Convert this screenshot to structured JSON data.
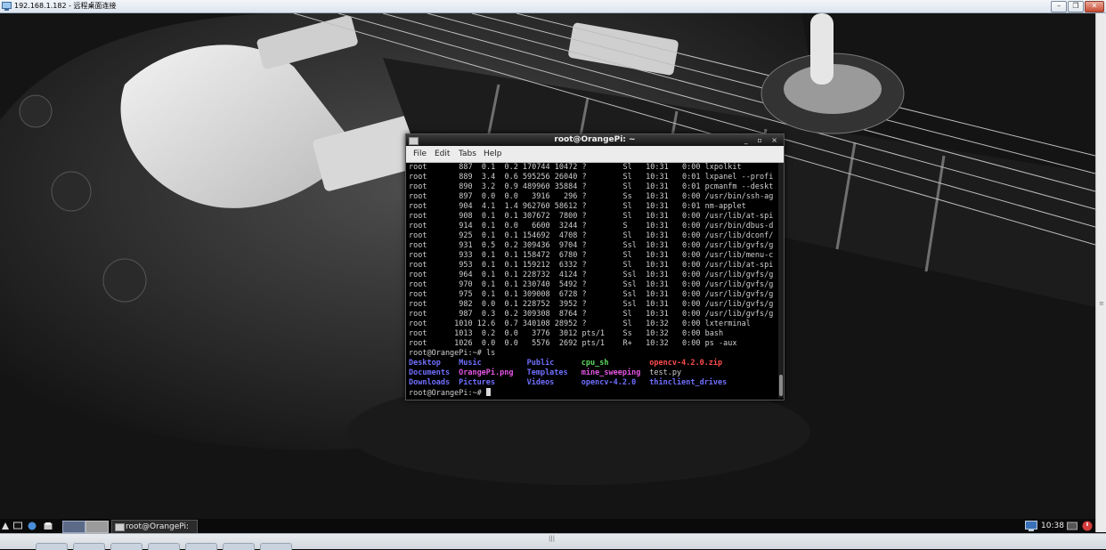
{
  "window": {
    "title": "192.168.1.182 - 远程桌面连接",
    "buttons": [
      "–",
      "❐",
      "✕"
    ]
  },
  "terminal": {
    "title": "root@OrangePi: ~",
    "title_buttons": "_ ▫ ×",
    "menu": [
      "File",
      "Edit",
      "Tabs",
      "Help"
    ],
    "ps_lines": [
      "root       887  0.1  0.2 170744 10472 ?        Sl   10:31   0:00 lxpolkit",
      "root       889  3.4  0.6 595256 26040 ?        Sl   10:31   0:01 lxpanel --profi",
      "root       890  3.2  0.9 489960 35884 ?        Sl   10:31   0:01 pcmanfm --deskt",
      "root       897  0.0  0.0   3916   296 ?        Ss   10:31   0:00 /usr/bin/ssh-ag",
      "root       904  4.1  1.4 962760 58612 ?        Sl   10:31   0:01 nm-applet",
      "root       908  0.1  0.1 307672  7800 ?        Sl   10:31   0:00 /usr/lib/at-spi",
      "root       914  0.1  0.0   6600  3244 ?        S    10:31   0:00 /usr/bin/dbus-d",
      "root       925  0.1  0.1 154692  4708 ?        Sl   10:31   0:00 /usr/lib/dconf/",
      "root       931  0.5  0.2 309436  9704 ?        Ssl  10:31   0:00 /usr/lib/gvfs/g",
      "root       933  0.1  0.1 158472  6780 ?        Sl   10:31   0:00 /usr/lib/menu-c",
      "root       953  0.1  0.1 159212  6332 ?        Sl   10:31   0:00 /usr/lib/at-spi",
      "root       964  0.1  0.1 228732  4124 ?        Ssl  10:31   0:00 /usr/lib/gvfs/g",
      "root       970  0.1  0.1 230740  5492 ?        Ssl  10:31   0:00 /usr/lib/gvfs/g",
      "root       975  0.1  0.1 309008  6728 ?        Ssl  10:31   0:00 /usr/lib/gvfs/g",
      "root       982  0.0  0.1 228752  3952 ?        Ssl  10:31   0:00 /usr/lib/gvfs/g",
      "root       987  0.3  0.2 309308  8764 ?        Sl   10:31   0:00 /usr/lib/gvfs/g",
      "root      1010 12.6  0.7 340108 28952 ?        Sl   10:32   0:00 lxterminal",
      "root      1013  0.2  0.0   3776  3012 pts/1    Ss   10:32   0:00 bash",
      "root      1026  0.0  0.0   5576  2692 pts/1    R+   10:32   0:00 ps -aux"
    ],
    "ls_command": "root@OrangePi:~# ls",
    "ls_rows": [
      [
        {
          "name": "Desktop",
          "type": "dir"
        },
        {
          "name": "Music",
          "type": "dir"
        },
        {
          "name": "Public",
          "type": "dir"
        },
        {
          "name": "cpu_sh",
          "type": "exe"
        },
        {
          "name": "opencv-4.2.0.zip",
          "type": "zip"
        }
      ],
      [
        {
          "name": "Documents",
          "type": "dir"
        },
        {
          "name": "OrangePi.png",
          "type": "png"
        },
        {
          "name": "Templates",
          "type": "dir"
        },
        {
          "name": "mine_sweeping",
          "type": "png"
        },
        {
          "name": "test.py",
          "type": "file"
        }
      ],
      [
        {
          "name": "Downloads",
          "type": "dir"
        },
        {
          "name": "Pictures",
          "type": "dir"
        },
        {
          "name": "Videos",
          "type": "dir"
        },
        {
          "name": "opencv-4.2.0",
          "type": "dir"
        },
        {
          "name": "thinclient_drives",
          "type": "dir"
        }
      ]
    ],
    "prompt": "root@OrangePi:~# "
  },
  "panel": {
    "task_label": "root@OrangePi: ~",
    "clock": "10:38",
    "icons": [
      "menu-icon",
      "terminal-icon",
      "browser-icon",
      "file-manager-icon",
      "desktop-1-icon",
      "desktop-2-icon",
      "network-icon",
      "volume-icon",
      "shutdown-icon"
    ]
  }
}
